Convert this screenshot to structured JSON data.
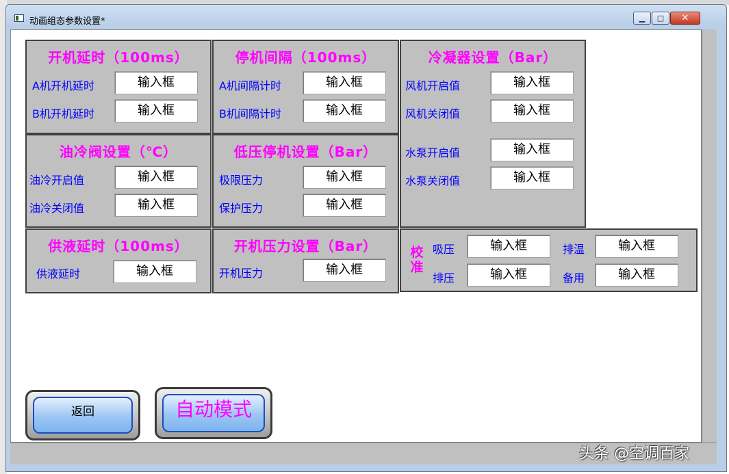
{
  "window": {
    "title": "动画组态参数设置*"
  },
  "input_placeholder": "输入框",
  "panels": {
    "start_delay": {
      "title": "开机延时（100ms）",
      "a_label": "A机开机延时",
      "b_label": "B机开机延时"
    },
    "stop_interval": {
      "title": "停机间隔（100ms）",
      "a_label": "A机间隔计时",
      "b_label": "B机间隔计时"
    },
    "condenser": {
      "title": "冷凝器设置（Bar）",
      "fan_on": "风机开启值",
      "fan_off": "风机关闭值",
      "pump_on": "水泵开启值",
      "pump_off": "水泵关闭值"
    },
    "oil_cool": {
      "title": "油冷阀设置（℃）",
      "on_label": "油冷开启值",
      "off_label": "油冷关闭值"
    },
    "low_pressure": {
      "title": "低压停机设置（Bar）",
      "limit_label": "极限压力",
      "protect_label": "保护压力"
    },
    "liquid_delay": {
      "title": "供液延时（100ms）",
      "label": "供液延时"
    },
    "start_pressure": {
      "title": "开机压力设置（Bar）",
      "label": "开机压力"
    },
    "calibration": {
      "title_chars": [
        "校",
        "准"
      ],
      "suction": "吸压",
      "discharge": "排压",
      "discharge_temp": "排温",
      "spare": "备用"
    }
  },
  "buttons": {
    "back": "返回",
    "auto_mode": "自动模式"
  },
  "watermark": "头条 @空调百家",
  "colors": {
    "title": "#ff00ff",
    "label": "#0000ff",
    "panel": "#c0c0c0"
  }
}
